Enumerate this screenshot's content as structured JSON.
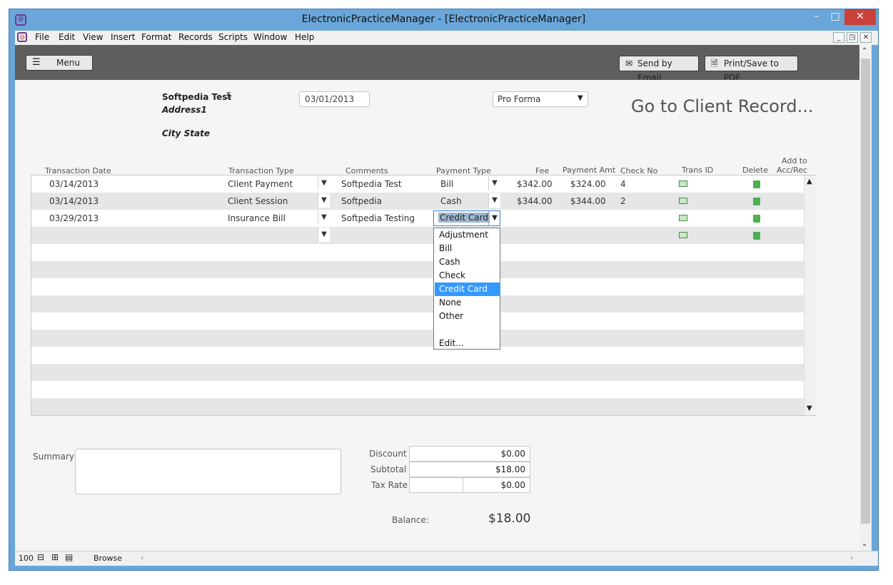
{
  "window": {
    "title": "ElectronicPracticeManager - [ElectronicPracticeManager]"
  },
  "window_buttons": [
    "–",
    "□",
    "✕"
  ],
  "mdi_buttons": [
    "_",
    "◳",
    "✕"
  ],
  "menu": [
    "File",
    "Edit",
    "View",
    "Insert",
    "Format",
    "Records",
    "Scripts",
    "Window",
    "Help"
  ],
  "toolbar": {
    "menu_label": "Menu",
    "email_label": "Send by Email",
    "pdf_label": "Print/Save to PDF"
  },
  "client": {
    "name": "Softpedia Test",
    "number": "5",
    "address": "Address1",
    "city": "City State"
  },
  "invoice": {
    "date": "03/01/2013",
    "type": "Pro Forma",
    "goto_label": "Go to Client Record..."
  },
  "columns": [
    "Transaction Date",
    "Transaction Type",
    "Comments",
    "Payment Type",
    "Fee",
    "Payment Amt",
    "Check No",
    "Trans ID",
    "Delete",
    "Add to",
    "Acc/Rec"
  ],
  "rows": [
    {
      "date": "03/14/2013",
      "type": "Client Payment",
      "comments": "Softpedia Test",
      "payment": "Bill",
      "fee": "$342.00",
      "paid": "$324.00",
      "check": "4"
    },
    {
      "date": "03/14/2013",
      "type": "Client Session",
      "comments": "Softpedia",
      "payment": "Cash",
      "fee": "$344.00",
      "paid": "$344.00",
      "check": "2"
    },
    {
      "date": "03/29/2013",
      "type": "Insurance Bill",
      "comments": "Softpedia Testing",
      "payment": "Credit Card",
      "fee": "",
      "paid": "",
      "check": ""
    },
    {
      "date": "",
      "type": "",
      "comments": "",
      "payment": "",
      "fee": "",
      "paid": "",
      "check": ""
    }
  ],
  "payment_options": [
    "Adjustment",
    "Bill",
    "Cash",
    "Check",
    "Credit Card",
    "None",
    "Other",
    "",
    "Edit..."
  ],
  "summary": {
    "summary_label": "Summary",
    "discount_label": "Discount",
    "discount": "$0.00",
    "subtotal_label": "Subtotal",
    "subtotal": "$18.00",
    "tax_label": "Tax Rate",
    "tax": "$0.00",
    "balance_label": "Balance:",
    "balance": "$18.00"
  },
  "status": {
    "zoom": "100",
    "mode": "Browse"
  }
}
